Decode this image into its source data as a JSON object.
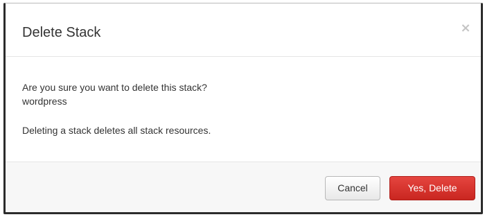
{
  "dialog": {
    "title": "Delete Stack",
    "close_glyph": "×",
    "confirm_question": "Are you sure you want to delete this stack?",
    "stack_name": "wordpress",
    "warning": "Deleting a stack deletes all stack resources.",
    "cancel_label": "Cancel",
    "confirm_label": "Yes, Delete"
  },
  "colors": {
    "danger": "#d9342d",
    "footer_bg": "#f7f7f7",
    "text": "#333333"
  },
  "icons": {
    "close": "close-icon"
  }
}
